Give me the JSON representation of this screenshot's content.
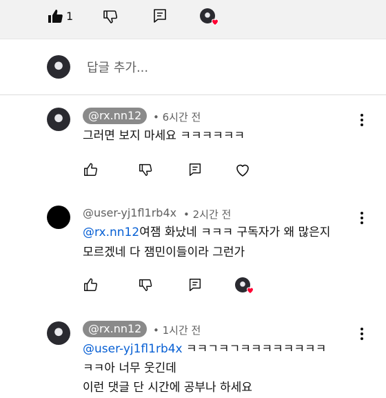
{
  "top_actions": {
    "like_count": "1"
  },
  "reply_input": {
    "placeholder": "답글 추가..."
  },
  "replies": [
    {
      "handle": "@rx.nn12",
      "time": "6시간 전",
      "lines": [
        "그러면 보지 마세요 ㅋㅋㅋㅋㅋㅋ"
      ]
    },
    {
      "handle": "@user-yj1fl1rb4x",
      "time": "2시간 전",
      "mention": "@rx.nn12",
      "lines": [
        "여잼 화났네 ㅋㅋㅋ 구독자가 왜 많은지",
        "모르겠네 다 잼민이들이라 그런가"
      ]
    },
    {
      "handle": "@rx.nn12",
      "time": "1시간 전",
      "mention": "@user-yj1fl1rb4x",
      "lines": [
        " ㅋㅋㄱㅋㄱㅋㅋㅋㅋㅋㅋㅋㅋ",
        "ㅋㅋ아 너무 웃긴데",
        "이런 댓글 단 시간에 공부나 하세요"
      ]
    }
  ],
  "colors": {
    "mention": "#065fd4",
    "heart": "#ff0033",
    "pill": "#8a8a8a"
  }
}
